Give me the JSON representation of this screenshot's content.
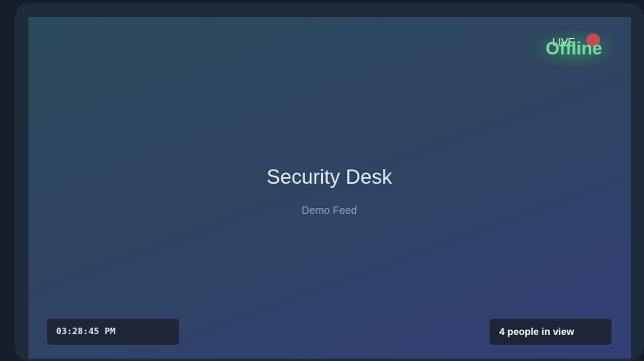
{
  "feed": {
    "title": "Security Desk",
    "subtitle": "Demo Feed"
  },
  "status": {
    "live_label": "LIVE",
    "state_label": "Offline",
    "live_dot_color": "#c7484f",
    "state_color": "#6fe09d"
  },
  "overlay": {
    "timestamp": "03:28:45 PM",
    "people_count": "4 people in view"
  }
}
